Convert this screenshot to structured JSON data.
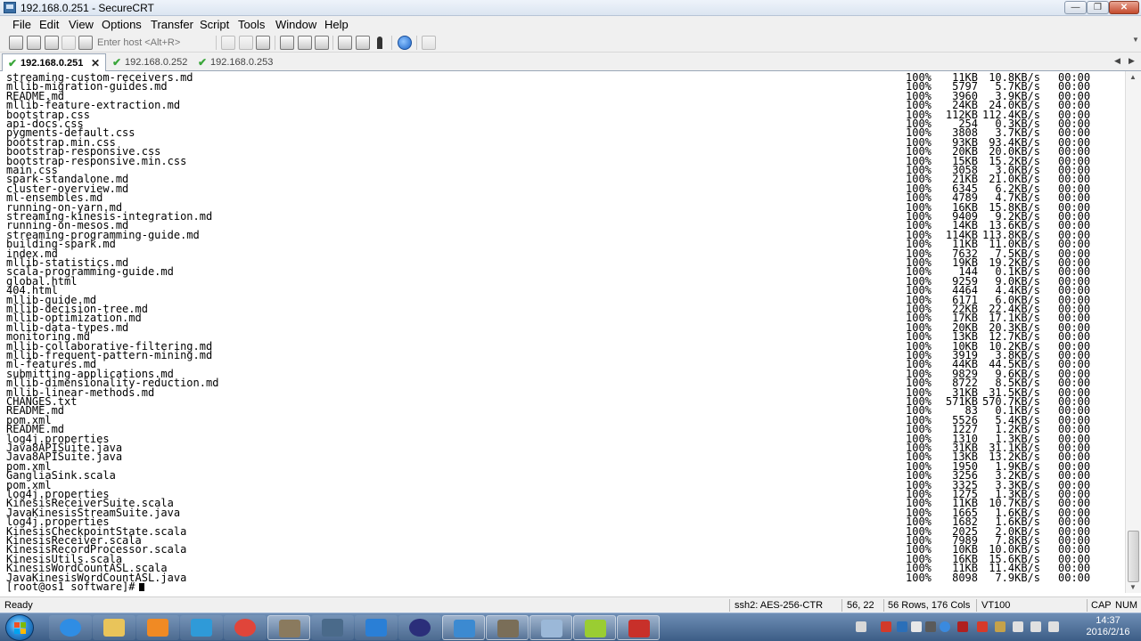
{
  "window": {
    "title": "192.168.0.251 - SecureCRT"
  },
  "menu": [
    "File",
    "Edit",
    "View",
    "Options",
    "Transfer",
    "Script",
    "Tools",
    "Window",
    "Help"
  ],
  "toolbar": {
    "host_placeholder": "Enter host <Alt+R>"
  },
  "tabs": [
    {
      "label": "192.168.0.251",
      "active": true
    },
    {
      "label": "192.168.0.252",
      "active": false
    },
    {
      "label": "192.168.0.253",
      "active": false
    }
  ],
  "terminal": {
    "rows": [
      {
        "name": "streaming-custom-receivers.md",
        "pct": "100%",
        "size": "11KB",
        "rate": "10.8KB/s",
        "time": "00:00"
      },
      {
        "name": "mllib-migration-guides.md",
        "pct": "100%",
        "size": "5797",
        "rate": "5.7KB/s",
        "time": "00:00"
      },
      {
        "name": "README.md",
        "pct": "100%",
        "size": "3960",
        "rate": "3.9KB/s",
        "time": "00:00"
      },
      {
        "name": "mllib-feature-extraction.md",
        "pct": "100%",
        "size": "24KB",
        "rate": "24.0KB/s",
        "time": "00:00"
      },
      {
        "name": "bootstrap.css",
        "pct": "100%",
        "size": "112KB",
        "rate": "112.4KB/s",
        "time": "00:00"
      },
      {
        "name": "api-docs.css",
        "pct": "100%",
        "size": "254",
        "rate": "0.3KB/s",
        "time": "00:00"
      },
      {
        "name": "pygments-default.css",
        "pct": "100%",
        "size": "3808",
        "rate": "3.7KB/s",
        "time": "00:00"
      },
      {
        "name": "bootstrap.min.css",
        "pct": "100%",
        "size": "93KB",
        "rate": "93.4KB/s",
        "time": "00:00"
      },
      {
        "name": "bootstrap-responsive.css",
        "pct": "100%",
        "size": "20KB",
        "rate": "20.0KB/s",
        "time": "00:00"
      },
      {
        "name": "bootstrap-responsive.min.css",
        "pct": "100%",
        "size": "15KB",
        "rate": "15.2KB/s",
        "time": "00:00"
      },
      {
        "name": "main.css",
        "pct": "100%",
        "size": "3058",
        "rate": "3.0KB/s",
        "time": "00:00"
      },
      {
        "name": "spark-standalone.md",
        "pct": "100%",
        "size": "21KB",
        "rate": "21.0KB/s",
        "time": "00:00"
      },
      {
        "name": "cluster-overview.md",
        "pct": "100%",
        "size": "6345",
        "rate": "6.2KB/s",
        "time": "00:00"
      },
      {
        "name": "ml-ensembles.md",
        "pct": "100%",
        "size": "4789",
        "rate": "4.7KB/s",
        "time": "00:00"
      },
      {
        "name": "running-on-yarn.md",
        "pct": "100%",
        "size": "16KB",
        "rate": "15.8KB/s",
        "time": "00:00"
      },
      {
        "name": "streaming-kinesis-integration.md",
        "pct": "100%",
        "size": "9409",
        "rate": "9.2KB/s",
        "time": "00:00"
      },
      {
        "name": "running-on-mesos.md",
        "pct": "100%",
        "size": "14KB",
        "rate": "13.6KB/s",
        "time": "00:00"
      },
      {
        "name": "streaming-programming-guide.md",
        "pct": "100%",
        "size": "114KB",
        "rate": "113.8KB/s",
        "time": "00:00"
      },
      {
        "name": "building-spark.md",
        "pct": "100%",
        "size": "11KB",
        "rate": "11.0KB/s",
        "time": "00:00"
      },
      {
        "name": "index.md",
        "pct": "100%",
        "size": "7632",
        "rate": "7.5KB/s",
        "time": "00:00"
      },
      {
        "name": "mllib-statistics.md",
        "pct": "100%",
        "size": "19KB",
        "rate": "19.2KB/s",
        "time": "00:00"
      },
      {
        "name": "scala-programming-guide.md",
        "pct": "100%",
        "size": "144",
        "rate": "0.1KB/s",
        "time": "00:00"
      },
      {
        "name": "global.html",
        "pct": "100%",
        "size": "9259",
        "rate": "9.0KB/s",
        "time": "00:00"
      },
      {
        "name": "404.html",
        "pct": "100%",
        "size": "4464",
        "rate": "4.4KB/s",
        "time": "00:00"
      },
      {
        "name": "mllib-guide.md",
        "pct": "100%",
        "size": "6171",
        "rate": "6.0KB/s",
        "time": "00:00"
      },
      {
        "name": "mllib-decision-tree.md",
        "pct": "100%",
        "size": "22KB",
        "rate": "22.4KB/s",
        "time": "00:00"
      },
      {
        "name": "mllib-optimization.md",
        "pct": "100%",
        "size": "17KB",
        "rate": "17.1KB/s",
        "time": "00:00"
      },
      {
        "name": "mllib-data-types.md",
        "pct": "100%",
        "size": "20KB",
        "rate": "20.3KB/s",
        "time": "00:00"
      },
      {
        "name": "monitoring.md",
        "pct": "100%",
        "size": "13KB",
        "rate": "12.7KB/s",
        "time": "00:00"
      },
      {
        "name": "mllib-collaborative-filtering.md",
        "pct": "100%",
        "size": "10KB",
        "rate": "10.2KB/s",
        "time": "00:00"
      },
      {
        "name": "mllib-frequent-pattern-mining.md",
        "pct": "100%",
        "size": "3919",
        "rate": "3.8KB/s",
        "time": "00:00"
      },
      {
        "name": "ml-features.md",
        "pct": "100%",
        "size": "44KB",
        "rate": "44.5KB/s",
        "time": "00:00"
      },
      {
        "name": "submitting-applications.md",
        "pct": "100%",
        "size": "9829",
        "rate": "9.6KB/s",
        "time": "00:00"
      },
      {
        "name": "mllib-dimensionality-reduction.md",
        "pct": "100%",
        "size": "8722",
        "rate": "8.5KB/s",
        "time": "00:00"
      },
      {
        "name": "mllib-linear-methods.md",
        "pct": "100%",
        "size": "31KB",
        "rate": "31.5KB/s",
        "time": "00:00"
      },
      {
        "name": "CHANGES.txt",
        "pct": "100%",
        "size": "571KB",
        "rate": "570.7KB/s",
        "time": "00:00"
      },
      {
        "name": "README.md",
        "pct": "100%",
        "size": "83",
        "rate": "0.1KB/s",
        "time": "00:00"
      },
      {
        "name": "pom.xml",
        "pct": "100%",
        "size": "5526",
        "rate": "5.4KB/s",
        "time": "00:00"
      },
      {
        "name": "README.md",
        "pct": "100%",
        "size": "1227",
        "rate": "1.2KB/s",
        "time": "00:00"
      },
      {
        "name": "log4j.properties",
        "pct": "100%",
        "size": "1310",
        "rate": "1.3KB/s",
        "time": "00:00"
      },
      {
        "name": "Java8APISuite.java",
        "pct": "100%",
        "size": "31KB",
        "rate": "31.1KB/s",
        "time": "00:00"
      },
      {
        "name": "Java8APISuite.java",
        "pct": "100%",
        "size": "13KB",
        "rate": "13.2KB/s",
        "time": "00:00"
      },
      {
        "name": "pom.xml",
        "pct": "100%",
        "size": "1950",
        "rate": "1.9KB/s",
        "time": "00:00"
      },
      {
        "name": "GangliaSink.scala",
        "pct": "100%",
        "size": "3256",
        "rate": "3.2KB/s",
        "time": "00:00"
      },
      {
        "name": "pom.xml",
        "pct": "100%",
        "size": "3325",
        "rate": "3.3KB/s",
        "time": "00:00"
      },
      {
        "name": "log4j.properties",
        "pct": "100%",
        "size": "1275",
        "rate": "1.3KB/s",
        "time": "00:00"
      },
      {
        "name": "KinesisReceiverSuite.scala",
        "pct": "100%",
        "size": "11KB",
        "rate": "10.7KB/s",
        "time": "00:00"
      },
      {
        "name": "JavaKinesisStreamSuite.java",
        "pct": "100%",
        "size": "1665",
        "rate": "1.6KB/s",
        "time": "00:00"
      },
      {
        "name": "log4j.properties",
        "pct": "100%",
        "size": "1682",
        "rate": "1.6KB/s",
        "time": "00:00"
      },
      {
        "name": "KinesisCheckpointState.scala",
        "pct": "100%",
        "size": "2025",
        "rate": "2.0KB/s",
        "time": "00:00"
      },
      {
        "name": "KinesisReceiver.scala",
        "pct": "100%",
        "size": "7989",
        "rate": "7.8KB/s",
        "time": "00:00"
      },
      {
        "name": "KinesisRecordProcessor.scala",
        "pct": "100%",
        "size": "10KB",
        "rate": "10.0KB/s",
        "time": "00:00"
      },
      {
        "name": "KinesisUtils.scala",
        "pct": "100%",
        "size": "16KB",
        "rate": "15.6KB/s",
        "time": "00:00"
      },
      {
        "name": "KinesisWordCountASL.scala",
        "pct": "100%",
        "size": "11KB",
        "rate": "11.4KB/s",
        "time": "00:00"
      },
      {
        "name": "JavaKinesisWordCountASL.java",
        "pct": "100%",
        "size": "8098",
        "rate": "7.9KB/s",
        "time": "00:00"
      }
    ],
    "prompt": "[root@os1 software]#"
  },
  "status": {
    "ready": "Ready",
    "cipher": "ssh2: AES-256-CTR",
    "cursor_pos": "56,  22",
    "dims": "56 Rows, 176 Cols",
    "emulation": "VT100",
    "caps": "CAP",
    "num": "NUM"
  },
  "taskbar": {
    "apps": [
      {
        "name": "ie-icon",
        "color": "#2f8de4",
        "state": "pinned"
      },
      {
        "name": "explorer-icon",
        "color": "#e9c45a",
        "state": "pinned"
      },
      {
        "name": "media-player-icon",
        "color": "#f08a24",
        "state": "pinned"
      },
      {
        "name": "network-app-icon",
        "color": "#2f9ad8",
        "state": "pinned"
      },
      {
        "name": "chrome-icon",
        "color": "#e0453a",
        "state": "pinned"
      },
      {
        "name": "archive-app-icon",
        "color": "#8a7a5e",
        "state": "running"
      },
      {
        "name": "tools-app-icon",
        "color": "#4a6a8a",
        "state": "pinned"
      },
      {
        "name": "feather-app-icon",
        "color": "#2a7fd6",
        "state": "pinned"
      },
      {
        "name": "eclipse-icon",
        "color": "#2b2e7a",
        "state": "pinned"
      },
      {
        "name": "virtualbox-icon",
        "color": "#3c8ad1",
        "state": "running"
      },
      {
        "name": "securecrt-icon",
        "color": "#7a6e58",
        "state": "running"
      },
      {
        "name": "remote-desktop-icon",
        "color": "#9bb8d8",
        "state": "running"
      },
      {
        "name": "mindmap-app-icon",
        "color": "#9acd32",
        "state": "running"
      },
      {
        "name": "pdf-app-icon",
        "color": "#c8302a",
        "state": "running"
      }
    ],
    "clock_time": "14:37",
    "clock_date": "2016/2/16"
  }
}
